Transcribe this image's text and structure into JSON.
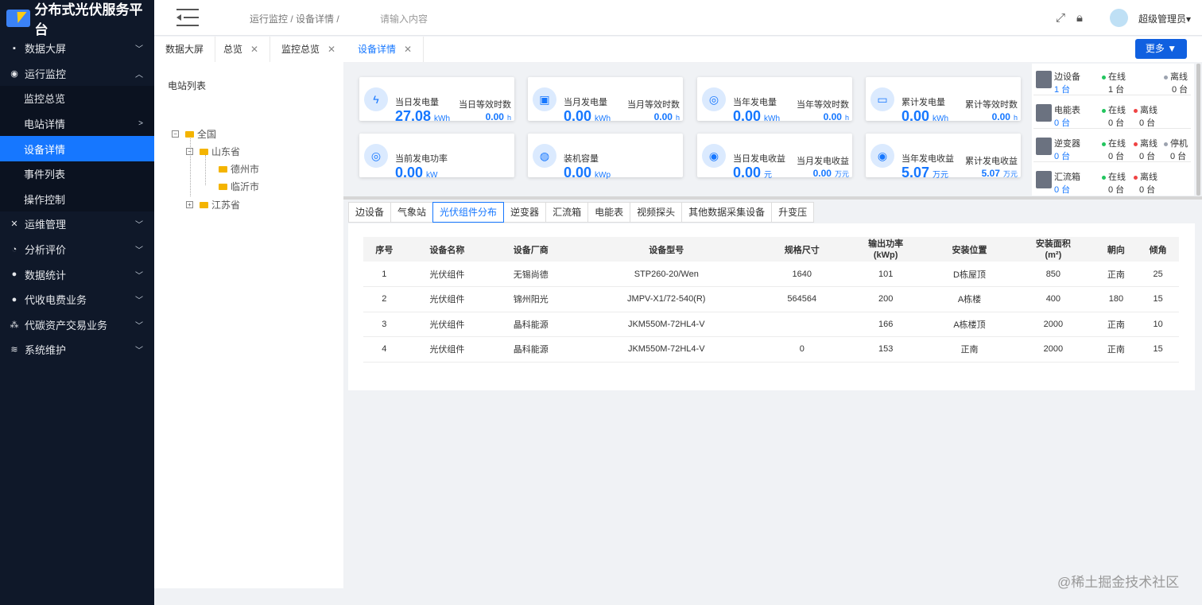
{
  "app": {
    "title": "分布式光伏服务平台"
  },
  "sidebar": {
    "items": [
      {
        "label": "数据大屏"
      },
      {
        "label": "运行监控"
      },
      {
        "label": "监控总览"
      },
      {
        "label": "电站详情"
      },
      {
        "label": "设备详情"
      },
      {
        "label": "事件列表"
      },
      {
        "label": "操作控制"
      },
      {
        "label": "运维管理"
      },
      {
        "label": "分析评价"
      },
      {
        "label": "数据统计"
      },
      {
        "label": "代收电费业务"
      },
      {
        "label": "代碳资产交易业务"
      },
      {
        "label": "系统维护"
      }
    ]
  },
  "header": {
    "breadcrumb": "运行监控  /  设备详情  /",
    "search_placeholder": "请输入内容",
    "user": "超级管理员"
  },
  "tabs": [
    {
      "label": "数据大屏"
    },
    {
      "label": "总览"
    },
    {
      "label": "监控总览"
    },
    {
      "label": "设备详情"
    }
  ],
  "more_button": "更多",
  "tree": {
    "title": "电站列表",
    "root": "全国",
    "prov1": "山东省",
    "city1": "德州市",
    "city2": "临沂市",
    "prov2": "江苏省"
  },
  "cards": [
    {
      "label": "当日发电量",
      "value": "27.08",
      "unit": "kWh",
      "rlabel": "当日等效时数",
      "rvalue": "0.00",
      "runit": "h"
    },
    {
      "label": "当月发电量",
      "value": "0.00",
      "unit": "kWh",
      "rlabel": "当月等效时数",
      "rvalue": "0.00",
      "runit": "h"
    },
    {
      "label": "当年发电量",
      "value": "0.00",
      "unit": "kWh",
      "rlabel": "当年等效时数",
      "rvalue": "0.00",
      "runit": "h"
    },
    {
      "label": "累计发电量",
      "value": "0.00",
      "unit": "kWh",
      "rlabel": "累计等效时数",
      "rvalue": "0.00",
      "runit": "h"
    },
    {
      "label": "当前发电功率",
      "value": "0.00",
      "unit": "kW",
      "rlabel": "",
      "rvalue": "",
      "runit": ""
    },
    {
      "label": "装机容量",
      "value": "0.00",
      "unit": "kWp",
      "rlabel": "",
      "rvalue": "",
      "runit": ""
    },
    {
      "label": "当日发电收益",
      "value": "0.00",
      "unit": "元",
      "rlabel": "当月发电收益",
      "rvalue": "0.00",
      "runit": "万元"
    },
    {
      "label": "当年发电收益",
      "value": "5.07",
      "unit": "万元",
      "rlabel": "累计发电收益",
      "rvalue": "5.07",
      "runit": "万元"
    }
  ],
  "devices": [
    {
      "name": "边设备",
      "count": "1 台",
      "s1": "在线",
      "c1": "1 台",
      "s2": "",
      "c2": "",
      "s3": "离线",
      "c3": "0 台"
    },
    {
      "name": "电能表",
      "count": "0 台",
      "s1": "在线",
      "c1": "0 台",
      "s2": "离线",
      "c2": "0 台",
      "s3": "",
      "c3": ""
    },
    {
      "name": "逆变器",
      "count": "0 台",
      "s1": "在线",
      "c1": "0 台",
      "s2": "离线",
      "c2": "0 台",
      "s3": "停机",
      "c3": "0 台"
    },
    {
      "name": "汇流箱",
      "count": "0 台",
      "s1": "在线",
      "c1": "0 台",
      "s2": "离线",
      "c2": "0 台",
      "s3": "",
      "c3": ""
    }
  ],
  "device_tabs": [
    {
      "label": "边设备"
    },
    {
      "label": "气象站"
    },
    {
      "label": "光伏组件分布"
    },
    {
      "label": "逆变器"
    },
    {
      "label": "汇流箱"
    },
    {
      "label": "电能表"
    },
    {
      "label": "视频探头"
    },
    {
      "label": "其他数据采集设备"
    },
    {
      "label": "升变压"
    }
  ],
  "table": {
    "headers": [
      "序号",
      "设备名称",
      "设备厂商",
      "设备型号",
      "规格尺寸",
      "输出功率\n(kWp)",
      "安装位置",
      "安装面积\n(m²)",
      "朝向",
      "倾角"
    ],
    "rows": [
      [
        "1",
        "光伏组件",
        "无锡尚德",
        "STP260-20/Wen",
        "1640",
        "101",
        "D栋屋顶",
        "850",
        "正南",
        "25"
      ],
      [
        "2",
        "光伏组件",
        "锦州阳光",
        "JMPV-X1/72-540(R)",
        "564564",
        "200",
        "A栋楼",
        "400",
        "180",
        "15"
      ],
      [
        "3",
        "光伏组件",
        "晶科能源",
        "JKM550M-72HL4-V",
        "",
        "166",
        "A栋楼顶",
        "2000",
        "正南",
        "10"
      ],
      [
        "4",
        "光伏组件",
        "晶科能源",
        "JKM550M-72HL4-V",
        "0",
        "153",
        "正南",
        "2000",
        "正南",
        "15"
      ]
    ]
  },
  "watermark": "@稀土掘金技术社区",
  "colors": {
    "accent": "#1677ff",
    "sidebar_bg": "#0f1829"
  }
}
